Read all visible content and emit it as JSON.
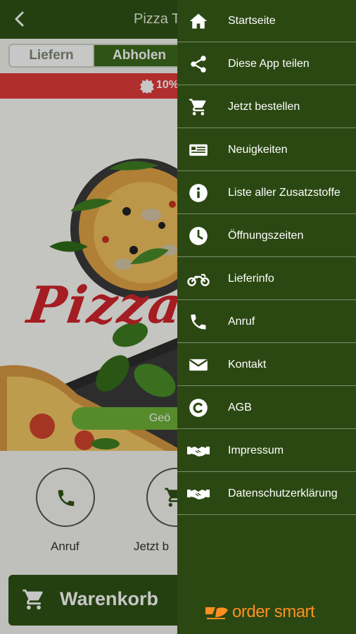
{
  "app": {
    "title": "Pizza T",
    "tabs": [
      "Liefern",
      "Abholen"
    ],
    "promo_text": "10%",
    "logo_text": "Pizza",
    "hours_pill": "Geö",
    "actions": [
      {
        "label": "Anruf",
        "icon": "phone-icon"
      },
      {
        "label": "Jetzt b",
        "icon": "cart-icon"
      }
    ],
    "cart_button": "Warenkorb"
  },
  "drawer": {
    "items": [
      {
        "label": "Startseite",
        "icon": "home-icon"
      },
      {
        "label": "Diese App teilen",
        "icon": "share-icon"
      },
      {
        "label": "Jetzt bestellen",
        "icon": "cart-icon"
      },
      {
        "label": "Neuigkeiten",
        "icon": "newspaper-icon"
      },
      {
        "label": "Liste aller Zusatzstoffe",
        "icon": "info-icon"
      },
      {
        "label": "Öffnungszeiten",
        "icon": "clock-icon"
      },
      {
        "label": "Lieferinfo",
        "icon": "motorcycle-icon"
      },
      {
        "label": "Anruf",
        "icon": "phone-icon"
      },
      {
        "label": "Kontakt",
        "icon": "envelope-icon"
      },
      {
        "label": "AGB",
        "icon": "copyright-icon"
      },
      {
        "label": "Impressum",
        "icon": "handshake-icon"
      },
      {
        "label": "Datenschutzerklärung",
        "icon": "handshake-icon"
      }
    ],
    "brand": "order smart"
  },
  "colors": {
    "drawer_bg": "#2b4812",
    "topbar_bg": "#2f5315",
    "promo_red": "#e23b3b",
    "accent_green": "#6fb238",
    "brand_orange": "#ff8f1f"
  }
}
